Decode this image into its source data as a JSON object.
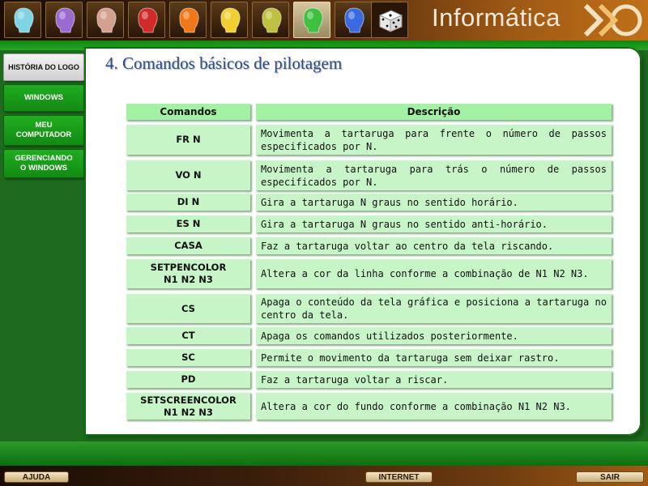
{
  "header": {
    "brand": "Informática",
    "tiles": [
      {
        "icon": "head-icon-cyan",
        "color": "#7fd4e4"
      },
      {
        "icon": "head-icon-purple",
        "color": "#9a6ad0"
      },
      {
        "icon": "head-icon-rose",
        "color": "#d4a090"
      },
      {
        "icon": "head-icon-red",
        "color": "#d02a2a"
      },
      {
        "icon": "head-icon-orange",
        "color": "#f07818"
      },
      {
        "icon": "head-icon-yellow",
        "color": "#f0d030"
      },
      {
        "icon": "head-icon-olive",
        "color": "#c0c040"
      },
      {
        "icon": "head-icon-green",
        "color": "#40c040"
      },
      {
        "icon": "head-icon-blue",
        "color": "#3a6ae0"
      },
      {
        "icon": "dice-icon",
        "color": "#ffffff"
      }
    ]
  },
  "sidebar": {
    "items": [
      {
        "label": "HISTÓRIA DO LOGO",
        "selected": true
      },
      {
        "label": "WINDOWS",
        "selected": false
      },
      {
        "label": "MEU\nCOMPUTADOR",
        "selected": false
      },
      {
        "label": "GERENCIANDO\nO WINDOWS",
        "selected": false
      }
    ]
  },
  "main": {
    "title": "4. Comandos básicos de pilotagem",
    "table": {
      "headers": [
        "Comandos",
        "Descrição"
      ],
      "rows": [
        {
          "cmd": "FR  N",
          "desc": "Movimenta a tartaruga para frente o número de passos especificados por N."
        },
        {
          "cmd": "VO  N",
          "desc": "Movimenta a tartaruga para trás o número de passos especificados por N."
        },
        {
          "cmd": "DI  N",
          "desc": "Gira a tartaruga N graus no sentido horário."
        },
        {
          "cmd": "ES  N",
          "desc": "Gira a tartaruga N graus no sentido anti-horário."
        },
        {
          "cmd": "CASA",
          "desc": "Faz a tartaruga voltar ao centro da tela riscando."
        },
        {
          "cmd": "SETPENCOLOR\nN1  N2  N3",
          "desc": "Altera a cor da linha conforme a combinação de N1  N2  N3."
        },
        {
          "cmd": "CS",
          "desc": "Apaga o conteúdo da tela gráfica e posiciona a tartaruga no centro da tela."
        },
        {
          "cmd": "CT",
          "desc": "Apaga os comandos utilizados posteriormente."
        },
        {
          "cmd": "SC",
          "desc": "Permite o movimento da tartaruga sem deixar rastro."
        },
        {
          "cmd": "PD",
          "desc": "Faz a tartaruga voltar a riscar."
        },
        {
          "cmd": "SETSCREENCOLOR\nN1  N2  N3",
          "desc": "Altera a cor do fundo conforme a combinação N1  N2  N3."
        }
      ]
    }
  },
  "footer": {
    "help_label": "AJUDA",
    "internet_label": "INTERNET",
    "exit_label": "SAIR"
  }
}
